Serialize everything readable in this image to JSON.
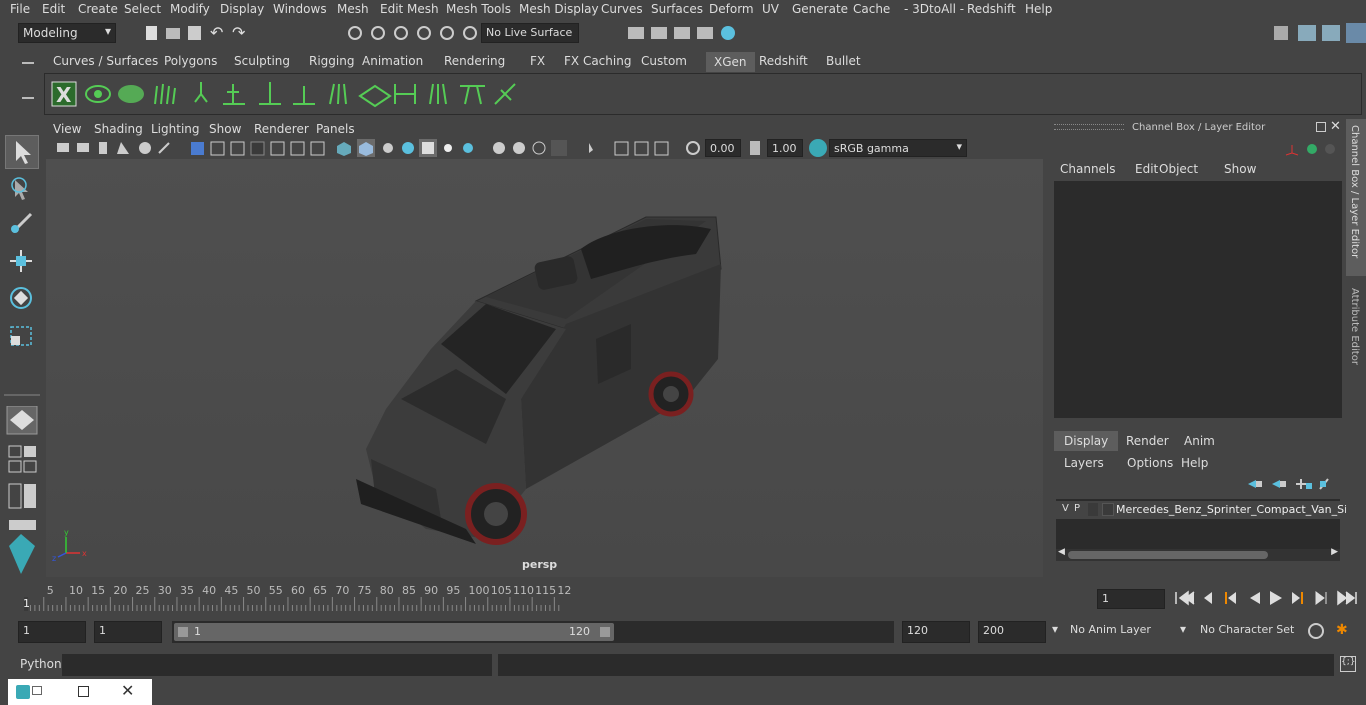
{
  "menu": [
    "File",
    "Edit",
    "Create",
    "Select",
    "Modify",
    "Display",
    "Windows",
    "Mesh",
    "Edit Mesh",
    "Mesh Tools",
    "Mesh Display",
    "Curves",
    "Surfaces",
    "Deform",
    "UV",
    "Generate",
    "Cache",
    "- 3DtoAll -",
    "Redshift",
    "Help"
  ],
  "mode": "Modeling",
  "live_surface": "No Live Surface",
  "shelf_tabs": [
    "Curves / Surfaces",
    "Polygons",
    "Sculpting",
    "Rigging",
    "Animation",
    "Rendering",
    "FX",
    "FX Caching",
    "Custom",
    "XGen",
    "Redshift",
    "Bullet"
  ],
  "active_shelf": "XGen",
  "viewport": {
    "menus": [
      "View",
      "Shading",
      "Lighting",
      "Show",
      "Renderer",
      "Panels"
    ],
    "exposure": "0.00",
    "gamma": "1.00",
    "colorspace": "sRGB gamma",
    "camera": "persp"
  },
  "channel_box": {
    "title": "Channel Box / Layer Editor",
    "menus": [
      "Channels",
      "Edit",
      "Object",
      "Show"
    ],
    "tabs": [
      "Display",
      "Render",
      "Anim"
    ],
    "layer_menus": [
      "Layers",
      "Options",
      "Help"
    ],
    "layer": {
      "v": "V",
      "p": "P",
      "name": "Mercedes_Benz_Sprinter_Compact_Van_Sim"
    },
    "side_tabs": [
      "Channel Box / Layer Editor",
      "Attribute Editor"
    ]
  },
  "timeline": {
    "ticks": [
      "5",
      "10",
      "15",
      "20",
      "25",
      "30",
      "35",
      "40",
      "45",
      "50",
      "55",
      "60",
      "65",
      "70",
      "75",
      "80",
      "85",
      "90",
      "95",
      "100",
      "105",
      "110",
      "115",
      "12"
    ],
    "start_marker": "1",
    "current": "1"
  },
  "range": {
    "start": "1",
    "start2": "1",
    "slider_start": "1",
    "slider_end": "120",
    "end": "120",
    "end2": "200",
    "anim_layer": "No Anim Layer",
    "char_set": "No Character Set"
  },
  "cmd": {
    "label": "Python"
  }
}
